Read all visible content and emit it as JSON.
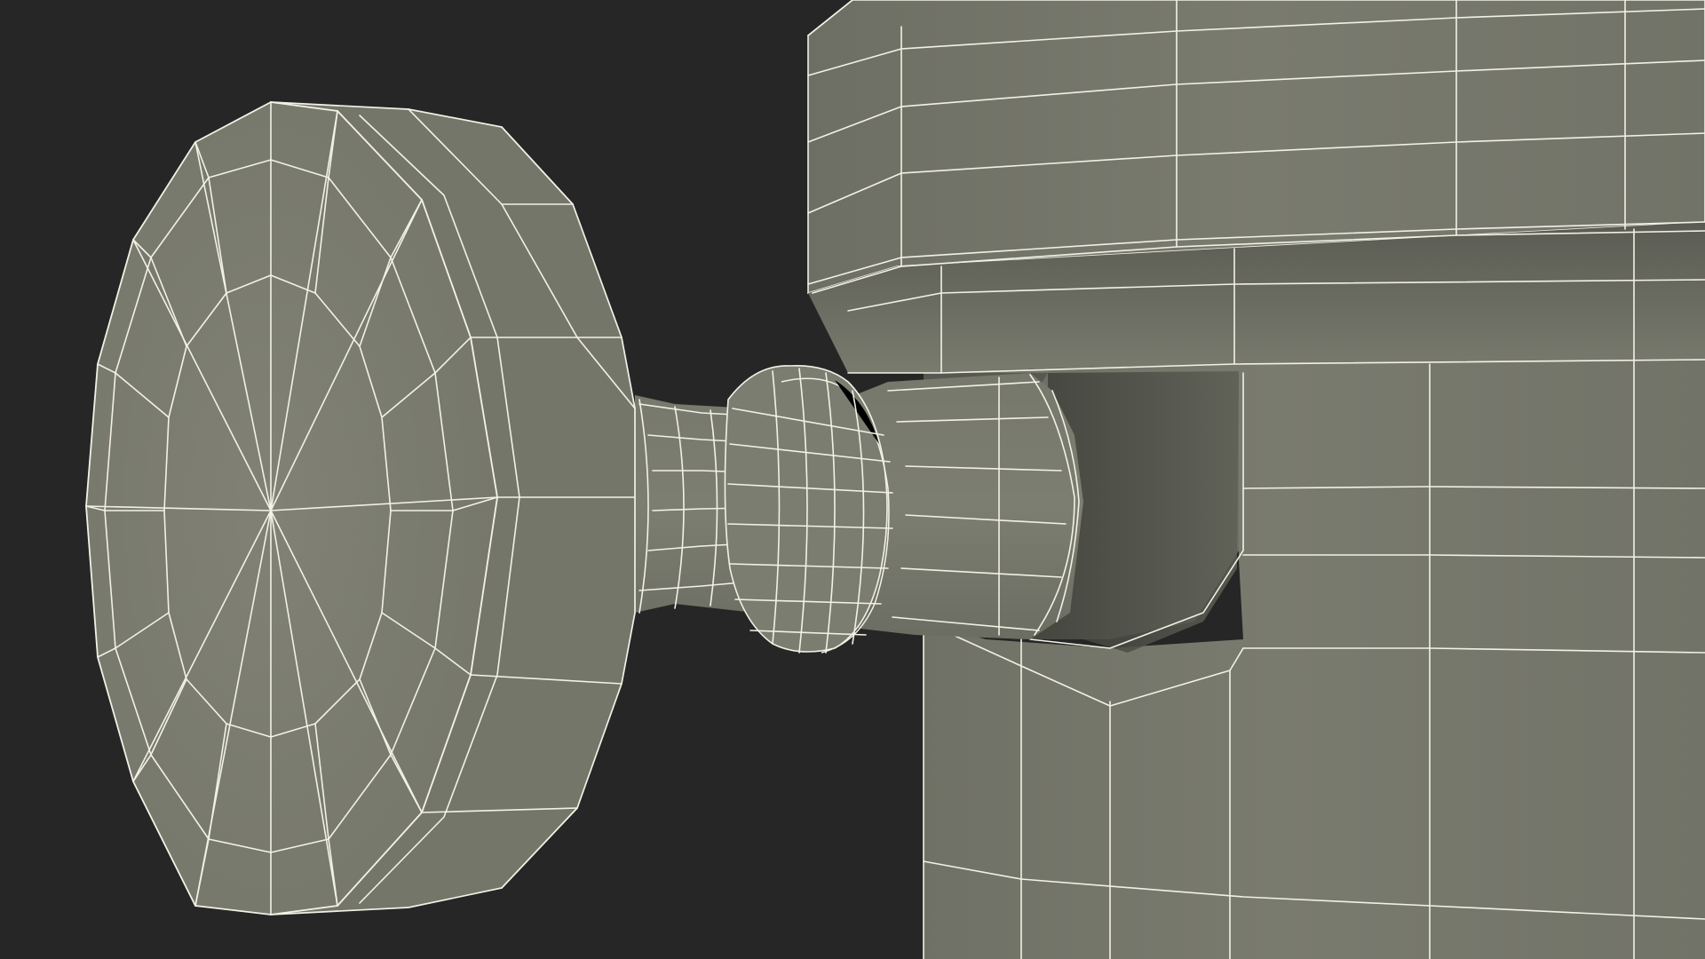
{
  "scene": {
    "description_type": "3d-wireframe-render",
    "background_color": "#262626",
    "mesh_color": "#7b7c6f",
    "mesh_shadow_color": "#5a5b51",
    "wire_color": "#f3f1e6"
  },
  "objects": {
    "knob": {
      "icon": "knob-head-icon"
    },
    "stem": {
      "icon": "knob-stem-icon"
    },
    "collar": {
      "icon": "collar-ring-icon"
    },
    "housing": {
      "icon": "cylinder-housing-icon"
    }
  }
}
